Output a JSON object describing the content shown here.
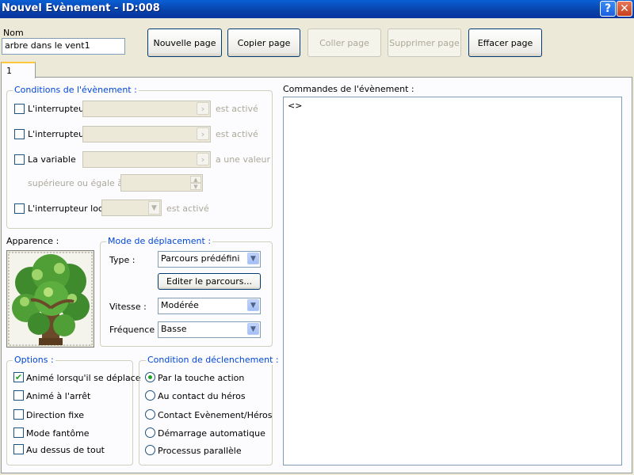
{
  "window": {
    "title": "Nouvel Evènement - ID:008",
    "help_label": "?",
    "close_label": "✕"
  },
  "name_field": {
    "label": "Nom",
    "value": "arbre dans le vent1"
  },
  "toolbar": {
    "new_page": "Nouvelle page",
    "copy_page": "Copier page",
    "paste_page": "Coller page",
    "delete_page": "Supprimer page",
    "clear_page": "Effacer page"
  },
  "tabs": [
    {
      "label": "1"
    }
  ],
  "conditions": {
    "title": "Conditions de l'évènement :",
    "switch1": {
      "label": "L'interrupteur",
      "suffix": "est activé",
      "checked": false
    },
    "switch2": {
      "label": "L'interrupteur",
      "suffix": "est activé",
      "checked": false
    },
    "variable": {
      "label": "La variable",
      "suffix": "a une valeur",
      "checked": false
    },
    "variable_compare_label": "supérieure ou égale à",
    "local_switch": {
      "label": "L'interrupteur local",
      "suffix": "est activé",
      "checked": false
    },
    "browse_button": "›"
  },
  "appearance": {
    "label": "Apparence :",
    "sprite": "tree-sprite"
  },
  "movement": {
    "title": "Mode de déplacement :",
    "type_label": "Type :",
    "type_value": "Parcours prédéfini",
    "edit_route": "Editer le parcours...",
    "speed_label": "Vitesse :",
    "speed_value": "Modérée",
    "frequency_label": "Fréquence :",
    "frequency_value": "Basse"
  },
  "options": {
    "title": "Options :",
    "items": [
      {
        "label": "Animé lorsqu'il se déplace",
        "checked": true
      },
      {
        "label": "Animé à l'arrêt",
        "checked": false
      },
      {
        "label": "Direction fixe",
        "checked": false
      },
      {
        "label": "Mode fantôme",
        "checked": false
      },
      {
        "label": "Au dessus de tout",
        "checked": false
      }
    ]
  },
  "trigger": {
    "title": "Condition de déclenchement :",
    "items": [
      {
        "label": "Par la touche action",
        "selected": true
      },
      {
        "label": "Au contact du héros",
        "selected": false
      },
      {
        "label": "Contact Evènement/Héros",
        "selected": false
      },
      {
        "label": "Démarrage automatique",
        "selected": false
      },
      {
        "label": "Processus parallèle",
        "selected": false
      }
    ]
  },
  "commands": {
    "title": "Commandes de l'évènement :",
    "lines": [
      "<>"
    ]
  },
  "colors": {
    "titlebar": "#0841a8",
    "group_title": "#0046d5",
    "panel": "#fcfcfe",
    "window": "#ece9d8",
    "check": "#21a121"
  }
}
